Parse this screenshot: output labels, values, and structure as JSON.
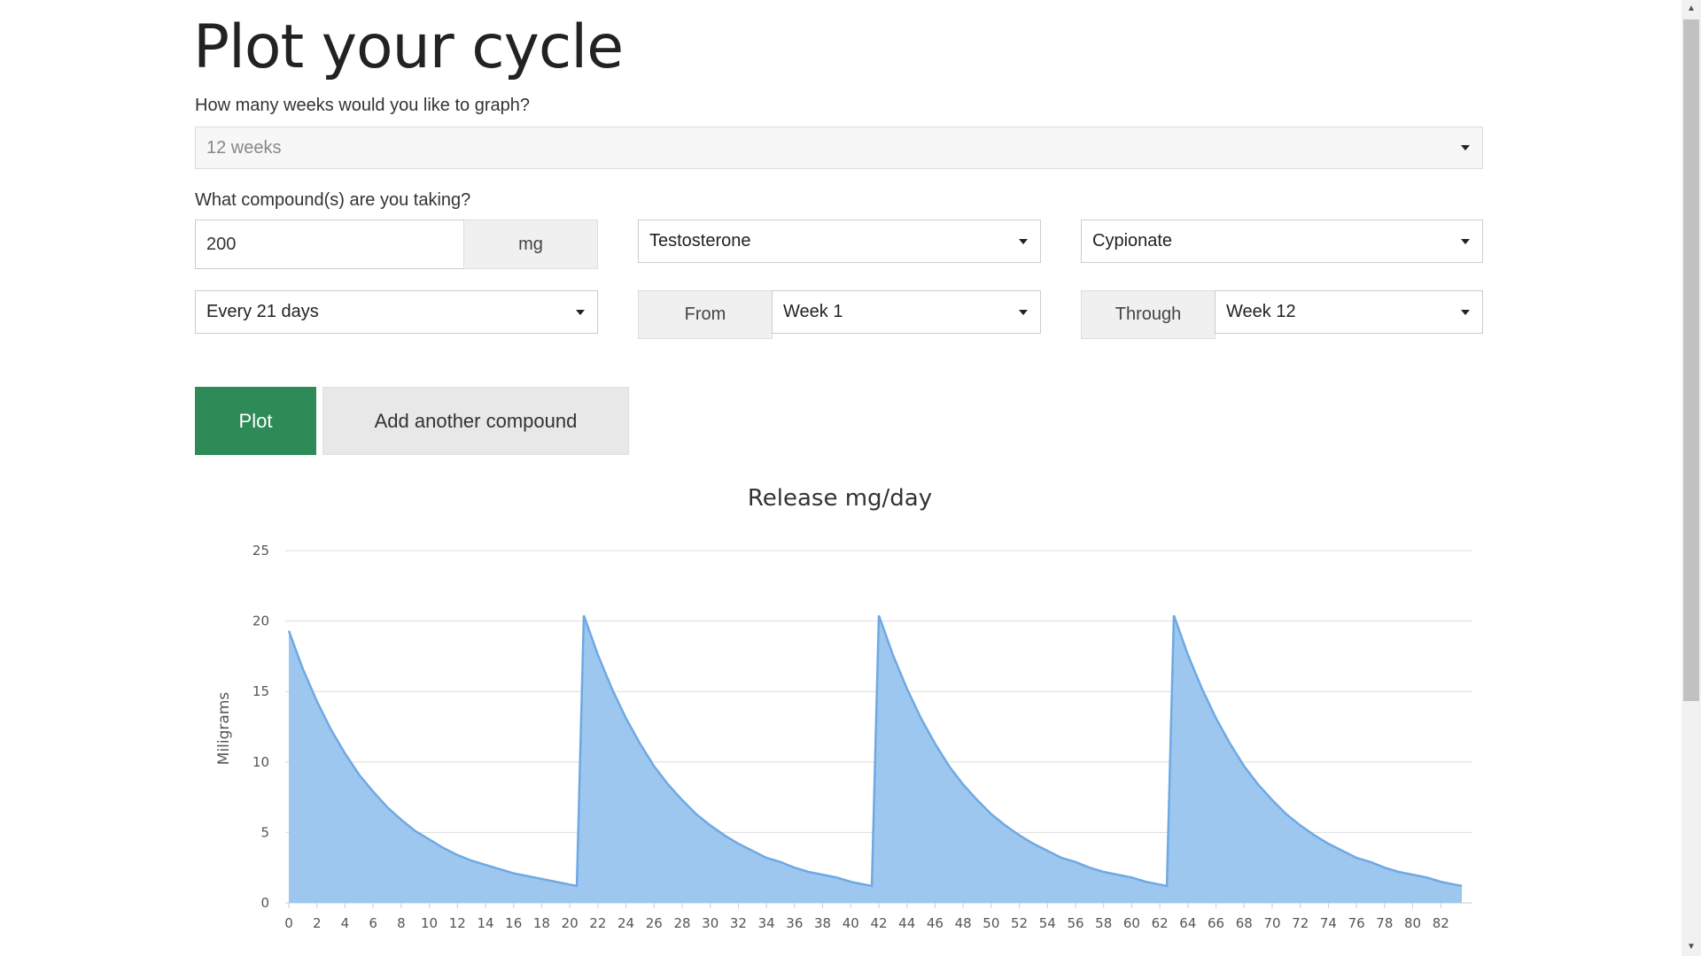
{
  "page": {
    "title": "Plot your cycle"
  },
  "weeks": {
    "question": "How many weeks would you like to graph?",
    "selected": "12 weeks"
  },
  "compound": {
    "question": "What compound(s) are you taking?",
    "dose_value": "200",
    "dose_unit": "mg",
    "compound_selected": "Testosterone",
    "ester_selected": "Cypionate",
    "frequency_selected": "Every 21 days",
    "from_label": "From",
    "from_selected": "Week 1",
    "through_label": "Through",
    "through_selected": "Week 12"
  },
  "actions": {
    "plot_label": "Plot",
    "add_label": "Add another compound"
  },
  "colors": {
    "primary_button": "#2e8b57",
    "area_fill": "#9ec7ef",
    "area_stroke": "#6ea9e3"
  },
  "chart_data": {
    "type": "area",
    "title": "Release mg/day",
    "ylabel": "Miligrams",
    "xlabel": "",
    "xlim": [
      0,
      84
    ],
    "ylim": [
      0,
      25
    ],
    "y_ticks": [
      0,
      5,
      10,
      15,
      20,
      25
    ],
    "x_ticks": [
      0,
      2,
      4,
      6,
      8,
      10,
      12,
      14,
      16,
      18,
      20,
      22,
      24,
      26,
      28,
      30,
      32,
      34,
      36,
      38,
      40,
      42,
      44,
      46,
      48,
      50,
      52,
      54,
      56,
      58,
      60,
      62,
      64,
      66,
      68,
      70,
      72,
      74,
      76,
      78,
      80,
      82
    ],
    "grid": true,
    "legend": "none",
    "series": [
      {
        "x": [
          0,
          1,
          2,
          3,
          4,
          5,
          6,
          7,
          8,
          9,
          10,
          11,
          12,
          13,
          14,
          15,
          16,
          17,
          18,
          19,
          20,
          20.5,
          21,
          22,
          23,
          24,
          25,
          26,
          27,
          28,
          29,
          30,
          31,
          32,
          33,
          34,
          35,
          36,
          37,
          38,
          39,
          40,
          41,
          41.5,
          42,
          43,
          44,
          45,
          46,
          47,
          48,
          49,
          50,
          51,
          52,
          53,
          54,
          55,
          56,
          57,
          58,
          59,
          60,
          61,
          62,
          62.5,
          63,
          64,
          65,
          66,
          67,
          68,
          69,
          70,
          71,
          72,
          73,
          74,
          75,
          76,
          77,
          78,
          79,
          80,
          81,
          82,
          83,
          83.5
        ],
        "y": [
          19.3,
          16.6,
          14.3,
          12.3,
          10.6,
          9.1,
          7.9,
          6.8,
          5.9,
          5.1,
          4.5,
          3.9,
          3.4,
          3.0,
          2.7,
          2.4,
          2.1,
          1.9,
          1.7,
          1.5,
          1.3,
          1.2,
          20.4,
          17.6,
          15.2,
          13.1,
          11.3,
          9.7,
          8.4,
          7.3,
          6.3,
          5.5,
          4.8,
          4.2,
          3.7,
          3.2,
          2.9,
          2.5,
          2.2,
          2.0,
          1.8,
          1.5,
          1.3,
          1.2,
          20.4,
          17.6,
          15.2,
          13.1,
          11.3,
          9.7,
          8.4,
          7.3,
          6.3,
          5.5,
          4.8,
          4.2,
          3.7,
          3.2,
          2.9,
          2.5,
          2.2,
          2.0,
          1.8,
          1.5,
          1.3,
          1.2,
          20.4,
          17.6,
          15.2,
          13.1,
          11.3,
          9.7,
          8.4,
          7.3,
          6.3,
          5.5,
          4.8,
          4.2,
          3.7,
          3.2,
          2.9,
          2.5,
          2.2,
          2.0,
          1.8,
          1.5,
          1.3,
          1.2
        ]
      }
    ]
  }
}
